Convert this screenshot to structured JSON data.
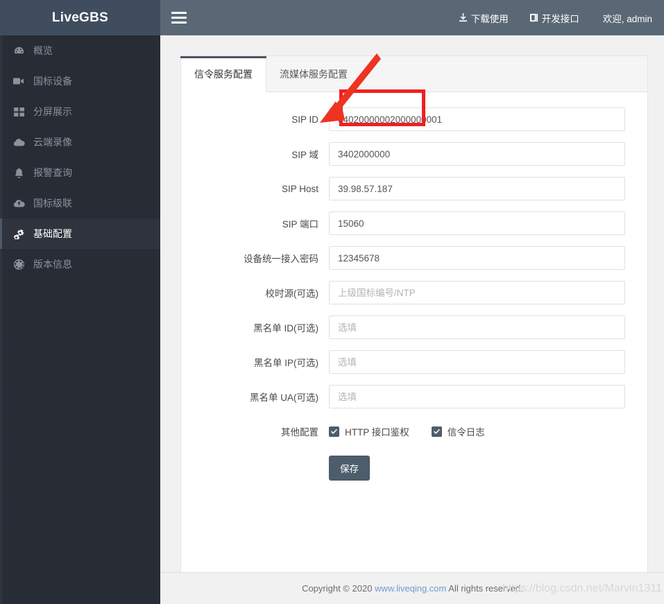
{
  "brand": {
    "logo_text": "LiveGBS"
  },
  "sidebar": {
    "items": [
      {
        "label": "概览",
        "icon": "dashboard-icon",
        "active": false
      },
      {
        "label": "国标设备",
        "icon": "video-camera-icon",
        "active": false
      },
      {
        "label": "分屏展示",
        "icon": "grid-icon",
        "active": false
      },
      {
        "label": "云端录像",
        "icon": "cloud-icon",
        "active": false
      },
      {
        "label": "报警查询",
        "icon": "bell-icon",
        "active": false
      },
      {
        "label": "国标级联",
        "icon": "cloud-upload-icon",
        "active": false
      },
      {
        "label": "基础配置",
        "icon": "cogs-icon",
        "active": true
      },
      {
        "label": "版本信息",
        "icon": "globe-icon",
        "active": false
      }
    ]
  },
  "topbar": {
    "menu_icon": "hamburger-icon",
    "links": [
      {
        "label": "下载使用",
        "icon": "download-icon"
      },
      {
        "label": "开发接口",
        "icon": "book-icon"
      }
    ],
    "user": "欢迎, admin"
  },
  "tabs": [
    {
      "label": "信令服务配置",
      "active": true
    },
    {
      "label": "流媒体服务配置",
      "active": false
    }
  ],
  "form": {
    "fields": [
      {
        "label": "SIP ID",
        "value": "34020000002000000001",
        "placeholder": ""
      },
      {
        "label": "SIP 域",
        "value": "3402000000",
        "placeholder": ""
      },
      {
        "label": "SIP Host",
        "value": "39.98.57.187",
        "placeholder": ""
      },
      {
        "label": "SIP 端口",
        "value": "15060",
        "placeholder": ""
      },
      {
        "label": "设备统一接入密码",
        "value": "12345678",
        "placeholder": ""
      },
      {
        "label": "校时源(可选)",
        "value": "",
        "placeholder": "上级国标编号/NTP"
      },
      {
        "label": "黑名单 ID(可选)",
        "value": "",
        "placeholder": "选填"
      },
      {
        "label": "黑名单 IP(可选)",
        "value": "",
        "placeholder": "选填"
      },
      {
        "label": "黑名单 UA(可选)",
        "value": "",
        "placeholder": "选填"
      }
    ],
    "other_label": "其他配置",
    "checkboxes": [
      {
        "label": "HTTP 接口鉴权",
        "checked": true
      },
      {
        "label": "信令日志",
        "checked": true
      }
    ],
    "save_label": "保存"
  },
  "footer": {
    "copyright_prefix": "Copyright © 2020 ",
    "link": "www.liveqing.com",
    "copyright_suffix": " All rights reserved.",
    "watermark": "https://blog.csdn.net/Marvin1311"
  },
  "annotations": {
    "highlight_color": "#f02020",
    "arrow_color": "#ee3322"
  }
}
